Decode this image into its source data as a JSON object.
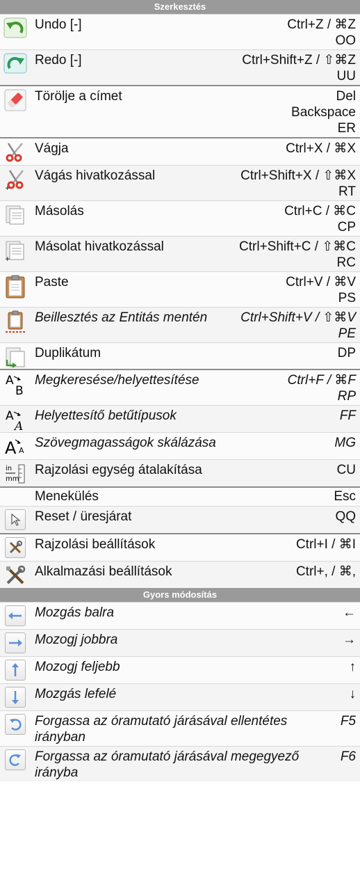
{
  "sections": {
    "edit_title": "Szerkesztés",
    "quick_title": "Gyors módosítás"
  },
  "items": [
    {
      "label": "Undo [-]",
      "shortcut": [
        "Ctrl+Z / ⌘Z",
        "OO"
      ],
      "icon": "undo-icon"
    },
    {
      "label": "Redo [-]",
      "shortcut": [
        "Ctrl+Shift+Z / ⇧⌘Z",
        "UU"
      ],
      "icon": "redo-icon"
    },
    {
      "label": "Törölje a címet",
      "shortcut": [
        "Del",
        "Backspace",
        "ER"
      ],
      "icon": "eraser-icon"
    },
    {
      "label": "Vágja",
      "shortcut": [
        "Ctrl+X / ⌘X"
      ],
      "icon": "scissors-icon"
    },
    {
      "label": "Vágás hivatkozással",
      "shortcut": [
        "Ctrl+Shift+X / ⇧⌘X",
        "RT"
      ],
      "icon": "scissors-ref-icon"
    },
    {
      "label": "Másolás",
      "shortcut": [
        "Ctrl+C / ⌘C",
        "CP"
      ],
      "icon": "copy-icon"
    },
    {
      "label": "Másolat hivatkozással",
      "shortcut": [
        "Ctrl+Shift+C / ⇧⌘C",
        "RC"
      ],
      "icon": "copy-ref-icon"
    },
    {
      "label": "Paste",
      "shortcut": [
        "Ctrl+V / ⌘V",
        "PS"
      ],
      "icon": "clipboard-icon"
    },
    {
      "label": "Beillesztés az Entitás mentén",
      "shortcut": [
        "Ctrl+Shift+V / ⇧⌘V",
        "PE"
      ],
      "icon": "clipboard-path-icon"
    },
    {
      "label": "Duplikátum",
      "shortcut": [
        "DP"
      ],
      "icon": "duplicate-icon"
    },
    {
      "label": "Megkeresése/helyettesítése",
      "shortcut": [
        "Ctrl+F / ⌘F",
        "RP"
      ],
      "icon": "find-replace-icon"
    },
    {
      "label": "Helyettesítő betűtípusok",
      "shortcut": [
        "FF"
      ],
      "icon": "font-replace-icon"
    },
    {
      "label": "Szövegmagasságok skálázása",
      "shortcut": [
        "MG"
      ],
      "icon": "text-scale-icon"
    },
    {
      "label": "Rajzolási egység átalakítása",
      "shortcut": [
        "CU"
      ],
      "icon": "unit-convert-icon"
    },
    {
      "label": "Menekülés",
      "shortcut": [
        "Esc"
      ],
      "icon": ""
    },
    {
      "label": "Reset / üresjárat",
      "shortcut": [
        "QQ"
      ],
      "icon": "cursor-icon"
    },
    {
      "label": "Rajzolási beállítások",
      "shortcut": [
        "Ctrl+I / ⌘I"
      ],
      "icon": "drawing-settings-icon"
    },
    {
      "label": "Alkalmazási beállítások",
      "shortcut": [
        "Ctrl+, / ⌘,"
      ],
      "icon": "app-settings-icon"
    }
  ],
  "quick": [
    {
      "label": "Mozgás balra",
      "shortcut": [
        "←"
      ],
      "icon": "arrow-left-icon"
    },
    {
      "label": "Mozogj jobbra",
      "shortcut": [
        "→"
      ],
      "icon": "arrow-right-icon"
    },
    {
      "label": "Mozogj feljebb",
      "shortcut": [
        "↑"
      ],
      "icon": "arrow-up-icon"
    },
    {
      "label": "Mozgás lefelé",
      "shortcut": [
        "↓"
      ],
      "icon": "arrow-down-icon"
    },
    {
      "label": "Forgassa az óramutató járásával ellentétes irányban",
      "shortcut": [
        "F5"
      ],
      "icon": "rotate-ccw-icon"
    },
    {
      "label": "Forgassa az óramutató járásával megegyező irányba",
      "shortcut": [
        "F6"
      ],
      "icon": "rotate-cw-icon"
    }
  ]
}
